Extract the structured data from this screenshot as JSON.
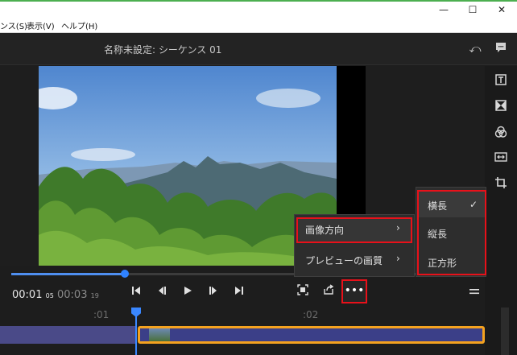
{
  "window": {
    "minimize": "—",
    "maximize": "☐",
    "close": "✕"
  },
  "menubar": {
    "items": [
      "ンス(S)",
      "表示(V)",
      "ヘルプ(H)"
    ]
  },
  "header": {
    "title": "名称未設定: シーケンス 01"
  },
  "preview": {
    "image": "mountain-landscape"
  },
  "transport": {
    "current_time": "00:01",
    "current_frames": "05",
    "duration": "00:03",
    "duration_frames": "19",
    "progress": 0.24
  },
  "timeline": {
    "ruler_labels": [
      ":01",
      ":02"
    ]
  },
  "context_menu": {
    "items": [
      {
        "label": "画像方向",
        "arrow": "›"
      },
      {
        "label": "プレビューの画質",
        "arrow": "›"
      }
    ]
  },
  "orientation_submenu": {
    "options": [
      "横長",
      "縦長",
      "正方形"
    ],
    "selected": "横長",
    "check": "✓"
  },
  "colors": {
    "accent": "#2f82ff",
    "highlight": "#e8111a",
    "clip_border": "#f4a21f"
  }
}
